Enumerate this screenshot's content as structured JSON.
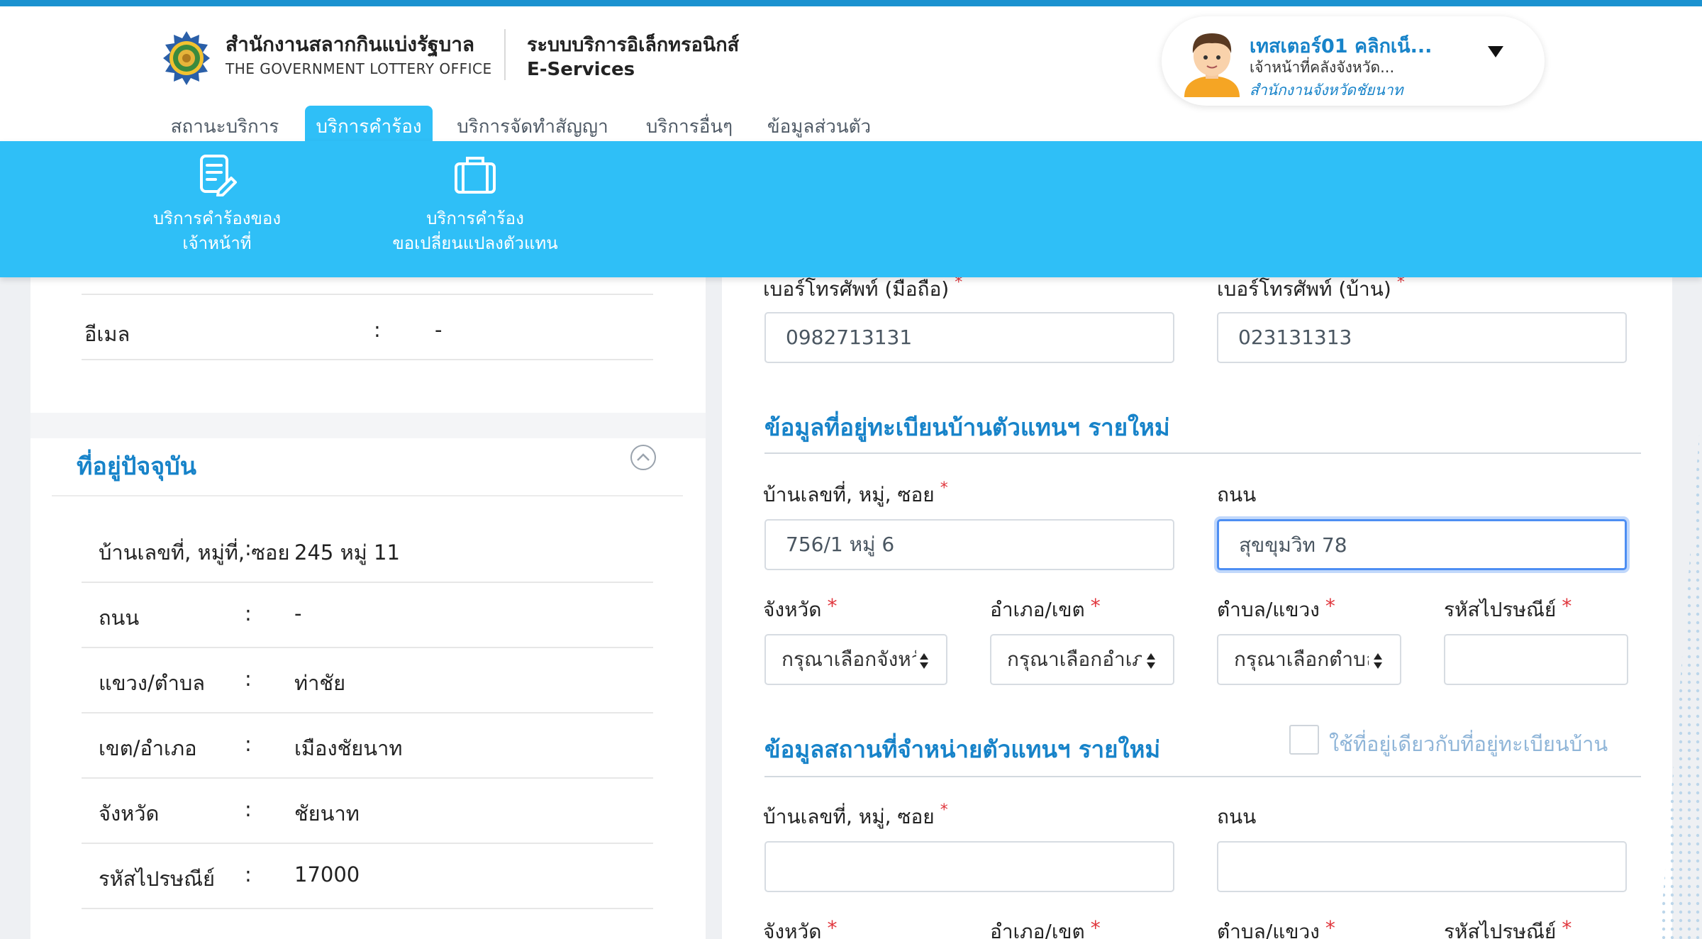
{
  "header": {
    "org_name_th": "สำนักงานสลากกินแบ่งรัฐบาล",
    "org_name_en": "THE GOVERNMENT LOTTERY OFFICE",
    "system_name_th": "ระบบบริการอิเล็กทรอนิกส์",
    "system_name_en": "E-Services"
  },
  "user": {
    "name": "เทสเตอร์01 คลิกเน็...",
    "role": "เจ้าหน้าที่คลังจังหวัด...",
    "office": "สำนักงานจังหวัดชัยนาท"
  },
  "tabs": [
    {
      "label": "สถานะบริการ"
    },
    {
      "label": "บริการคำร้อง"
    },
    {
      "label": "บริการจัดทำสัญญา"
    },
    {
      "label": "บริการอื่นๆ"
    },
    {
      "label": "ข้อมูลส่วนตัว"
    }
  ],
  "subnav": [
    {
      "line1": "บริการคำร้องของ",
      "line2": "เจ้าหน้าที่",
      "icon": "document-edit-icon"
    },
    {
      "line1": "บริการคำร้อง",
      "line2": "ขอเปลี่ยนแปลงตัวแทน",
      "icon": "briefcase-icon"
    }
  ],
  "left": {
    "email": {
      "label": "อีเมล",
      "colon": ":",
      "value": "-"
    },
    "address_title": "ที่อยู่ปัจจุบัน",
    "address_rows": [
      {
        "label": "บ้านเลขที่, หมู่ที่, ซอย",
        "colon": ":",
        "value": "245 หมู่ 11"
      },
      {
        "label": "ถนน",
        "colon": ":",
        "value": "-"
      },
      {
        "label": "แขวง/ตำบล",
        "colon": ":",
        "value": "ท่าชัย"
      },
      {
        "label": "เขต/อำเภอ",
        "colon": ":",
        "value": "เมืองชัยนาท"
      },
      {
        "label": "จังหวัด",
        "colon": ":",
        "value": "ชัยนาท"
      },
      {
        "label": "รหัสไปรษณีย์",
        "colon": ":",
        "value": "17000"
      }
    ]
  },
  "right": {
    "mobile_label": "เบอร์โทรศัพท์ (มือถือ)",
    "mobile_value": "0982713131",
    "home_phone_label": "เบอร์โทรศัพท์ (บ้าน)",
    "home_phone_value": "023131313",
    "required_mark": "*",
    "reg_section_title": "ข้อมูลที่อยู่ทะเบียนบ้านตัวแทนฯ รายใหม่",
    "reg_house_label": "บ้านเลขที่, หมู่, ซอย",
    "reg_house_value": "756/1 หมู่ 6",
    "reg_road_label": "ถนน",
    "reg_road_value": "สุขขุมวิท 78",
    "province_label": "จังหวัด",
    "district_label": "อำเภอ/เขต",
    "subdistrict_label": "ตำบล/แขวง",
    "postcode_label": "รหัสไปรษณีย์",
    "province_placeholder": "กรุณาเลือกจังหวัด",
    "district_placeholder": "กรุณาเลือกอำเภอ",
    "subdistrict_placeholder": "กรุณาเลือกตำบล",
    "shop_section_title": "ข้อมูลสถานที่จำหน่ายตัวแทนฯ รายใหม่",
    "same_address_label": "ใช้ที่อยู่เดียวกับที่อยู่ทะเบียนบ้าน",
    "shop_house_label": "บ้านเลขที่, หมู่, ซอย",
    "shop_road_label": "ถนน"
  },
  "colors": {
    "accent_blue": "#2fbff7",
    "title_blue": "#1783c9",
    "required_red": "#e0363d"
  }
}
